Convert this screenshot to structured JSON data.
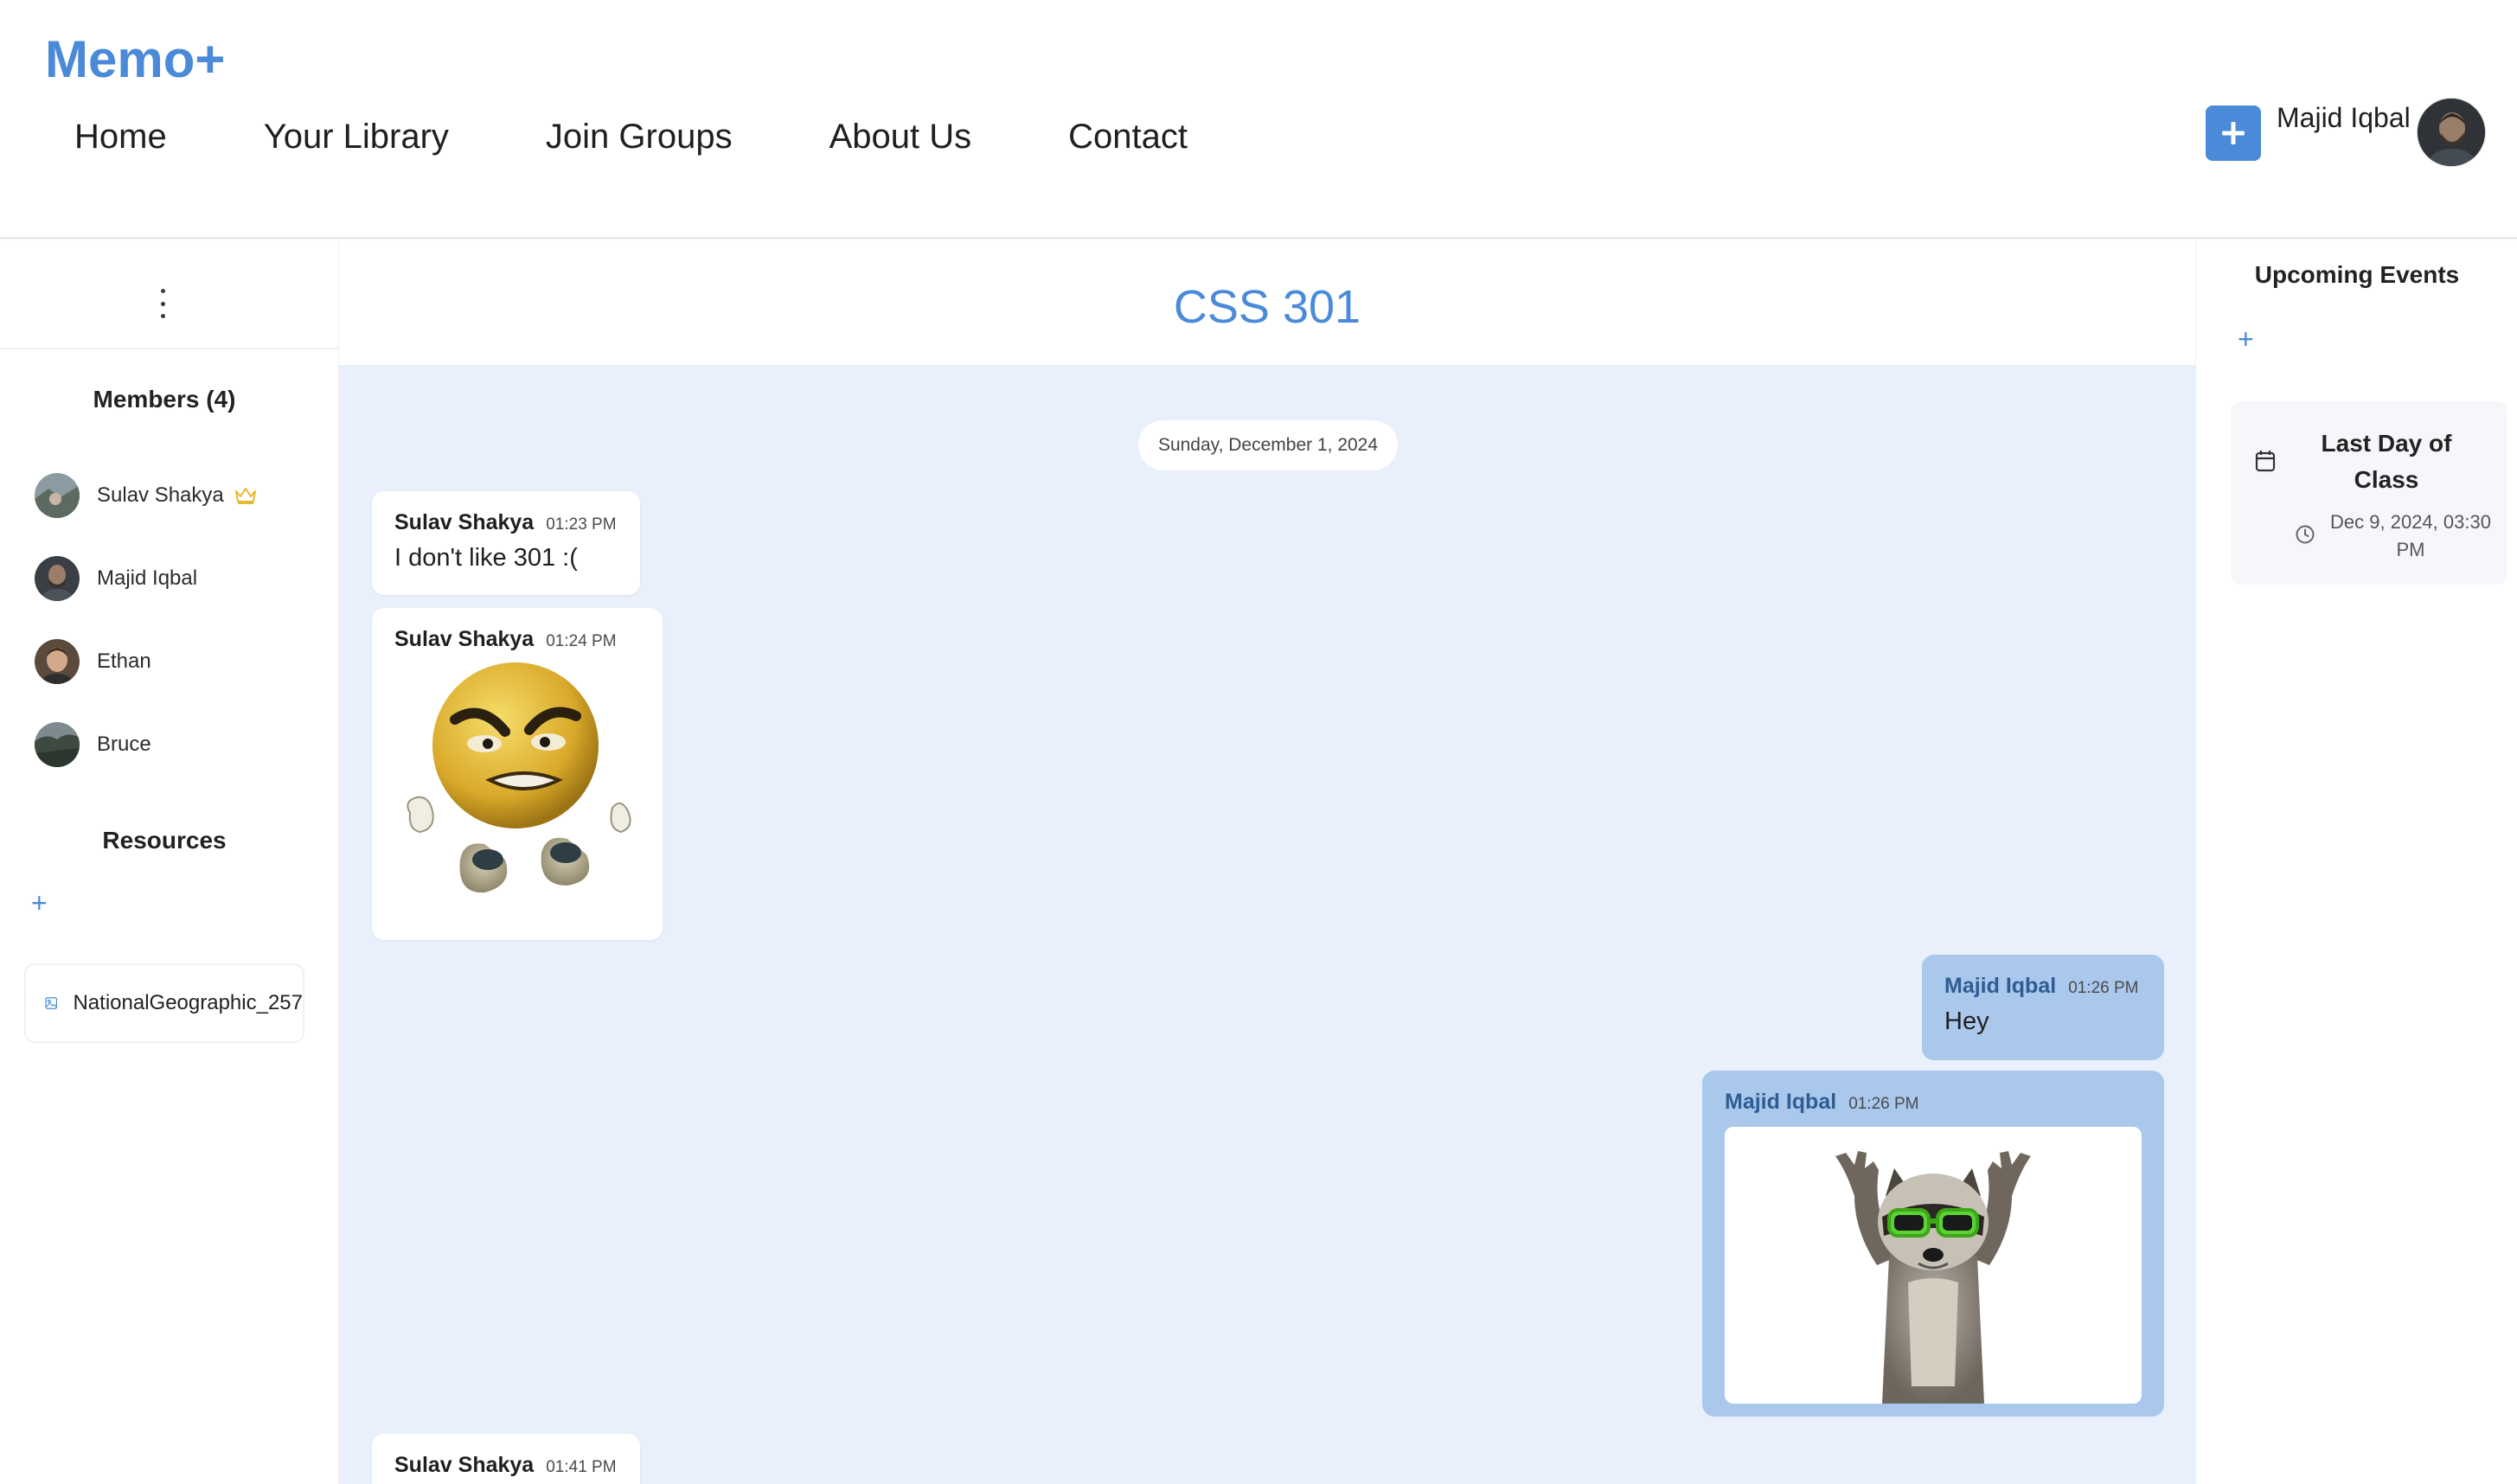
{
  "header": {
    "logo": "Memo+",
    "nav": [
      "Home",
      "Your Library",
      "Join Groups",
      "About Us",
      "Contact"
    ],
    "user_name": "Majid Iqbal"
  },
  "left": {
    "members_title": "Members (4)",
    "members": [
      {
        "name": "Sulav Shakya",
        "owner": true
      },
      {
        "name": "Majid Iqbal"
      },
      {
        "name": "Ethan"
      },
      {
        "name": "Bruce"
      }
    ],
    "resources_title": "Resources",
    "resources": [
      {
        "name": "NationalGeographic_257"
      }
    ]
  },
  "chat": {
    "title": "CSS 301",
    "date": "Sunday, December 1, 2024",
    "messages": [
      {
        "sender": "Sulav Shakya",
        "time": "01:23 PM",
        "text": "I don't like 301 :("
      },
      {
        "sender": "Sulav Shakya",
        "time": "01:24 PM"
      },
      {
        "sender": "Majid Iqbal",
        "time": "01:26 PM",
        "text": "Hey"
      },
      {
        "sender": "Majid Iqbal",
        "time": "01:26 PM"
      },
      {
        "sender": "Sulav Shakya",
        "time": "01:41 PM"
      }
    ]
  },
  "right": {
    "title": "Upcoming Events",
    "events": [
      {
        "title": "Last Day of Class",
        "time": "Dec 9, 2024, 03:30 PM"
      }
    ]
  },
  "colors": {
    "accent": "#4a8ad8",
    "chat_bg": "#e9f0fb",
    "outgoing_bubble": "#aac7ec",
    "crown": "#e6b92d"
  }
}
